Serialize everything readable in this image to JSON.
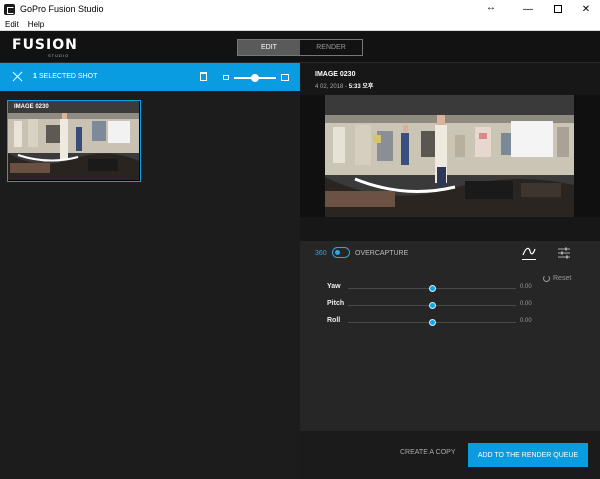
{
  "window": {
    "title": "GoPro Fusion Studio"
  },
  "menu": {
    "items": [
      "Edit",
      "Help"
    ]
  },
  "header": {
    "logo": "FUSION",
    "logo_sub": "STUDIO",
    "modes": [
      "EDIT",
      "RENDER"
    ],
    "active_mode": "EDIT"
  },
  "selection": {
    "count": "1",
    "label": "SELECTED SHOT"
  },
  "media": {
    "tile_label": "IMAGE 0230"
  },
  "info": {
    "title": "IMAGE 0230",
    "date": "4 02, 2018 -",
    "time": "5:33 오후"
  },
  "controls": {
    "mode_360": "360",
    "mode_overcapture": "OVERCAPTURE",
    "reset": "Reset",
    "rows": [
      {
        "label": "Yaw",
        "value": "0.00",
        "level": 0.5
      },
      {
        "label": "Pitch",
        "value": "0.00",
        "level": 0.5
      },
      {
        "label": "Roll",
        "value": "0.00",
        "level": 0.5
      }
    ]
  },
  "footer": {
    "copy": "CREATE A COPY",
    "queue": "ADD TO THE RENDER QUEUE"
  },
  "colors": {
    "accent": "#0a9ce0",
    "panel": "#262626",
    "background": "#1c1c1c"
  }
}
